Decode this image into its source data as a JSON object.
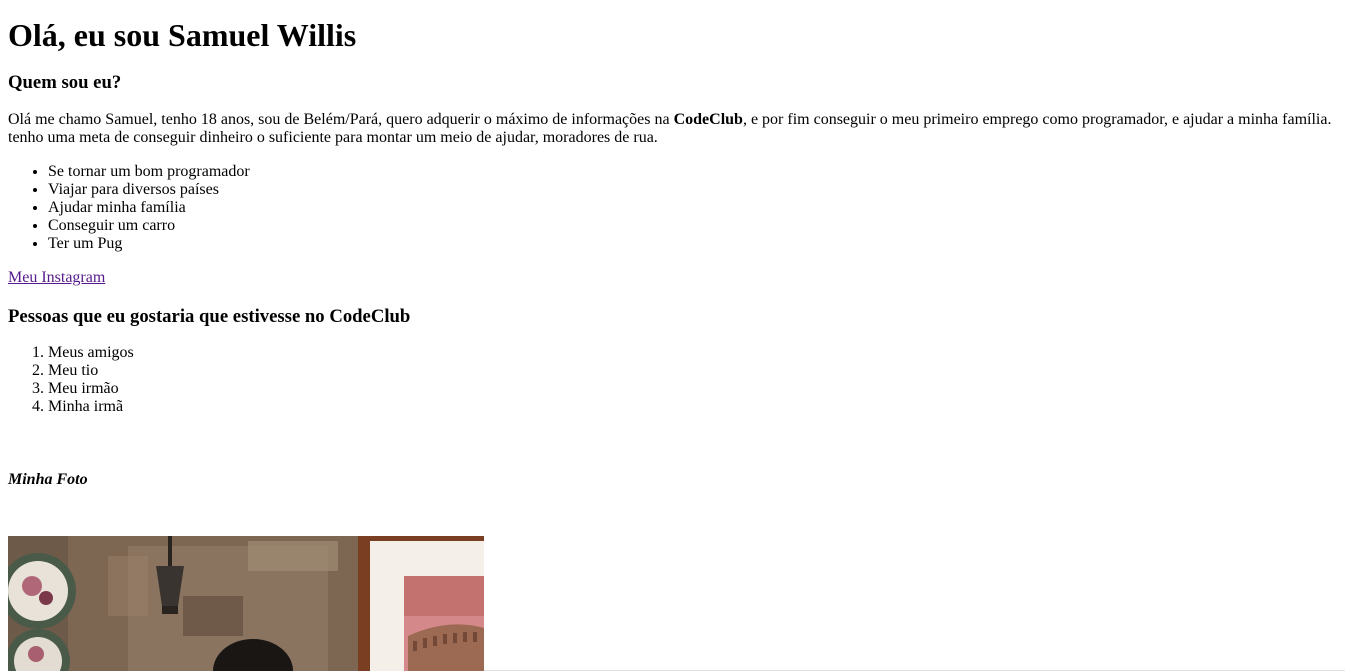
{
  "heading": "Olá, eu sou Samuel Willis",
  "about": {
    "title": "Quem sou eu?",
    "intro_before": "Olá me chamo Samuel, tenho 18 anos, sou de Belém/Pará, quero adquerir o máximo de informações na ",
    "intro_bold": "CodeClub",
    "intro_after": ", e por fim conseguir o meu primeiro emprego como programador, e ajudar a minha família.",
    "intro_line2": "tenho uma meta de conseguir dinheiro o suficiente para montar um meio de ajudar, moradores de rua."
  },
  "goals": [
    "Se tornar um bom programador",
    "Viajar para diversos países",
    "Ajudar minha família",
    "Conseguir um carro",
    "Ter um Pug"
  ],
  "instagram_link": "Meu Instagram",
  "people": {
    "title": "Pessoas que eu gostaria que estivesse no CodeClub",
    "items": [
      "Meus amigos",
      "Meu tio",
      "Meu irmão",
      "Minha irmã"
    ]
  },
  "photo": {
    "caption": "Minha Foto"
  },
  "colors": {
    "link_visited": "#551a8b",
    "text": "#000000",
    "background": "#ffffff"
  }
}
